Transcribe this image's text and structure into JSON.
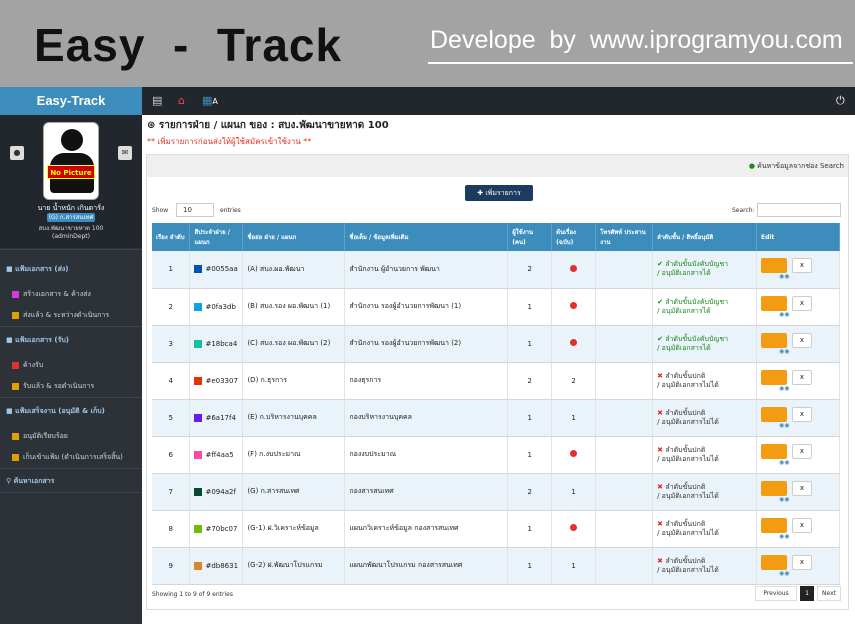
{
  "banner": {
    "title": "Easy  -  Track",
    "developer": "Develope  by  www.iprogramyou.com"
  },
  "brand": "Easy-Track",
  "topbar": {
    "icons": [
      "menu-toggle-icon",
      "home-icon",
      "chart-icon",
      "power-icon"
    ],
    "chart_suffix": "A"
  },
  "profile": {
    "avatar_tag": "No Picture",
    "name": "นาย น้ำหนัก เกินตารั่ง",
    "badge": "(G) ก.สารสนเทศ",
    "dept": "สบง.พัฒนาขายหาด 100",
    "user": "(adminDept)"
  },
  "menu": [
    {
      "type": "head",
      "label": "แฟ้มเอกสาร (ส่ง)"
    },
    {
      "type": "item",
      "label": "สร้างเอกสาร & ค้างส่ง",
      "color": "#d33be0"
    },
    {
      "type": "item",
      "label": "ส่งแล้ว & ระหว่างดำเนินการ",
      "color": "#e0a000"
    },
    {
      "type": "head",
      "label": "แฟ้มเอกสาร (รับ)"
    },
    {
      "type": "item",
      "label": "ค้างรับ",
      "color": "#e03030"
    },
    {
      "type": "item",
      "label": "รับแล้ว & รอดำเนินการ",
      "color": "#e0a000"
    },
    {
      "type": "head",
      "label": "แฟ้มเสร็จงาน (อนุมัติ & เก็บ)"
    },
    {
      "type": "item",
      "label": "อนุมัติเรียบร้อย",
      "color": "#e0a000"
    },
    {
      "type": "item",
      "label": "เก็บเข้าแฟ้ม (ดำเนินการเสร็จสิ้น)",
      "color": "#e0a000"
    },
    {
      "type": "head",
      "label": "ค้นหาเอกสาร"
    }
  ],
  "page": {
    "title": "รายการฝ่าย / แผนก ของ : สบง.พัฒนาขายหาด 100",
    "warning": "** เพิ่มรายการก่อนส่งให้ผู้ใช้สมัครเข้าใช้งาน **",
    "search_hint": "ค้นหาข้อมูลจากช่อง Search",
    "add_button": "เพิ่มรายการ",
    "show_label": "Show",
    "show_value": "10",
    "entries_label": "entries",
    "search_label": "Search:"
  },
  "table": {
    "headers": [
      "เรียง ลำดับ",
      "สีประจำฝ่าย / แผนก",
      "ชื่อย่อ ฝ่าย / แผนก",
      "ชื่อเต็ม / ข้อมูลเพิ่มเติม",
      "ผู้ใช้งาน (คน)",
      "ต้นเรื่อง (ฉบับ)",
      "โทรศัพท์ ประสานงาน",
      "ลำดับขั้น / สิทธิ์อนุมัติ",
      "Edit"
    ],
    "rows": [
      {
        "order": "1",
        "color": "#0055aa",
        "short": "(A) สบง.ผอ.พัฒนา",
        "full": "สำนักงาน ผู้อำนวยการ พัฒนา",
        "users": "2",
        "origin": "x",
        "phone": "",
        "perm_ok": true,
        "perm1": "ลำดับขั้นบังคับบัญชา",
        "perm2": "/ อนุมัติเอกสารได้"
      },
      {
        "order": "2",
        "color": "#0fa3db",
        "short": "(B) สบง.รอง ผอ.พัฒนา (1)",
        "full": "สำนักงาน รองผู้อำนวยการพัฒนา (1)",
        "users": "1",
        "origin": "x",
        "phone": "",
        "perm_ok": true,
        "perm1": "ลำดับขั้นบังคับบัญชา",
        "perm2": "/ อนุมัติเอกสารได้"
      },
      {
        "order": "3",
        "color": "#18bca4",
        "short": "(C) สบง.รอง ผอ.พัฒนา (2)",
        "full": "สำนักงาน รองผู้อำนวยการพัฒนา (2)",
        "users": "1",
        "origin": "x",
        "phone": "",
        "perm_ok": true,
        "perm1": "ลำดับขั้นบังคับบัญชา",
        "perm2": "/ อนุมัติเอกสารได้"
      },
      {
        "order": "4",
        "color": "#e03307",
        "short": "(D) ก.ธุรการ",
        "full": "กองธุรการ",
        "users": "2",
        "origin": "2",
        "phone": "",
        "perm_ok": false,
        "perm1": "ลำดับขั้นปกติ",
        "perm2": "/ อนุมัติเอกสารไม่ได้"
      },
      {
        "order": "5",
        "color": "#6a17f4",
        "short": "(E) ก.บริหารงานบุคคล",
        "full": "กองบริหารงานบุคคล",
        "users": "1",
        "origin": "1",
        "phone": "",
        "perm_ok": false,
        "perm1": "ลำดับขั้นปกติ",
        "perm2": "/ อนุมัติเอกสารไม่ได้"
      },
      {
        "order": "6",
        "color": "#ff4aa5",
        "short": "(F) ก.งบประมาณ",
        "full": "กองงบประมาณ",
        "users": "1",
        "origin": "x",
        "phone": "",
        "perm_ok": false,
        "perm1": "ลำดับขั้นปกติ",
        "perm2": "/ อนุมัติเอกสารไม่ได้"
      },
      {
        "order": "7",
        "color": "#094a2f",
        "short": "(G) ก.สารสนเทศ",
        "full": "กองสารสนเทศ",
        "users": "2",
        "origin": "1",
        "phone": "",
        "perm_ok": false,
        "perm1": "ลำดับขั้นปกติ",
        "perm2": "/ อนุมัติเอกสารไม่ได้"
      },
      {
        "order": "8",
        "color": "#70bc07",
        "short": "(G-1) ฝ.วิเคราะห์ข้อมูล",
        "full": "แผนกวิเคราะห์ข้อมูล กองสารสนเทศ",
        "users": "1",
        "origin": "x",
        "phone": "",
        "perm_ok": false,
        "perm1": "ลำดับขั้นปกติ",
        "perm2": "/ อนุมัติเอกสารไม่ได้"
      },
      {
        "order": "9",
        "color": "#db8631",
        "short": "(G-2) ฝ.พัฒนาโปรแกรม",
        "full": "แผนกพัฒนาโปรแกรม กองสารสนเทศ",
        "users": "1",
        "origin": "1",
        "phone": "",
        "perm_ok": false,
        "perm1": "ลำดับขั้นปกติ",
        "perm2": "/ อนุมัติเอกสารไม่ได้"
      }
    ],
    "delete_label": "x"
  },
  "footer": {
    "info": "Showing 1 to 9 of 9 entries",
    "prev": "Previous",
    "page": "1",
    "next": "Next"
  },
  "watermark": "by www.iprogramyou.com"
}
